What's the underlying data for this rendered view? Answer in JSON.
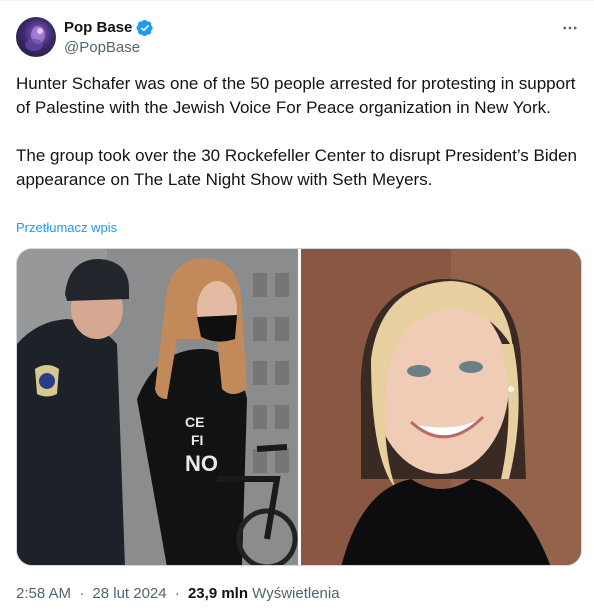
{
  "header": {
    "display_name": "Pop Base",
    "handle": "@PopBase",
    "avatar_icon": "pop-base-avatar",
    "verified_icon": "verified-badge-icon",
    "more_icon": "more-horizontal-icon"
  },
  "tweet": {
    "paragraphs": [
      "Hunter Schafer was one of the 50 people arrested for protesting in support of Palestine with the Jewish Voice For Peace organization in New York.",
      "The group took over the 30 Rockefeller Center to disrupt President’s Biden appearance on The Late Night Show with Seth Meyers."
    ],
    "translate_label": "Przetłumacz wpis"
  },
  "media": {
    "photos": [
      {
        "description": "photo-arrest"
      },
      {
        "description": "photo-portrait"
      }
    ]
  },
  "meta": {
    "time": "2:58 AM",
    "date": "28 lut 2024",
    "views_count": "23,9 mln",
    "views_label": "Wyświetlenia"
  },
  "colors": {
    "accent": "#1d9bf0",
    "text": "#0f1419",
    "secondary_text": "#536471",
    "border": "#cfd9de"
  }
}
